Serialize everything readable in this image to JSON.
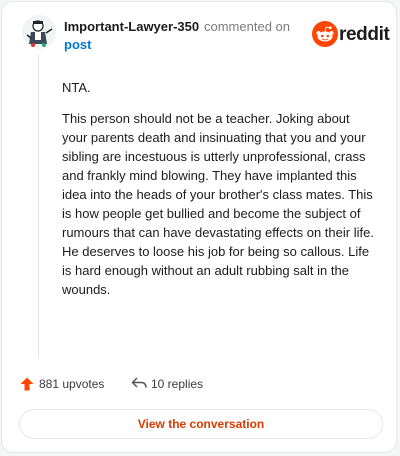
{
  "header": {
    "username": "Important-Lawyer-350",
    "action_text": "commented on",
    "post_link": "post",
    "brand": "reddit"
  },
  "comment": {
    "paragraphs": [
      "NTA.",
      "This person should not be a teacher. Joking about your parents death and insinuating that you and your sibling are incestuous is utterly unprofessional, crass and frankly mind blowing. They have implanted this idea into the heads of your brother's class mates. This is how people get bullied and become the subject of rumours that can have devastating effects on their life. He deserves to loose his job for being so callous. Life is hard enough without an adult rubbing salt in the wounds."
    ]
  },
  "footer": {
    "upvotes": "881 upvotes",
    "replies": "10 replies",
    "view_button": "View the conversation"
  },
  "colors": {
    "reddit_orange": "#ff4500",
    "link_blue": "#0079d3",
    "button_text": "#d93a00"
  },
  "icons": {
    "avatar": "user-avatar",
    "logo": "reddit-snoo-icon",
    "upvote": "upvote-arrow-icon",
    "reply": "reply-arrow-icon"
  }
}
